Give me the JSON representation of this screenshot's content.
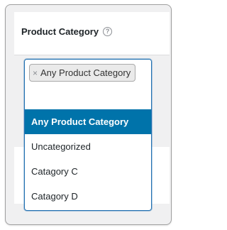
{
  "field": {
    "label": "Product Category",
    "help_icon": "question-circle-icon"
  },
  "selection": {
    "chip_label": "Any Product Category",
    "remove_glyph": "×"
  },
  "dropdown": {
    "options": [
      {
        "label": "Any Product Category",
        "highlighted": true
      },
      {
        "label": "Uncategorized",
        "highlighted": false
      },
      {
        "label": "Catagory C",
        "highlighted": false
      },
      {
        "label": "Catagory D",
        "highlighted": false
      }
    ]
  },
  "colors": {
    "accent": "#0073aa",
    "focus_border": "#2271b1"
  }
}
